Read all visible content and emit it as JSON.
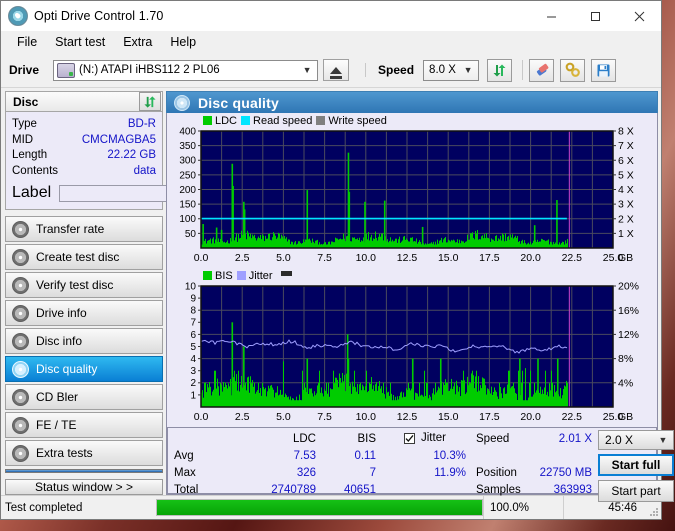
{
  "window": {
    "title": "Opti Drive Control 1.70",
    "app_icon": "disc-icon",
    "minimize": "minimize-icon",
    "maximize": "maximize-icon",
    "close": "close-icon"
  },
  "menu": {
    "items": [
      "File",
      "Start test",
      "Extra",
      "Help"
    ]
  },
  "toolbar": {
    "drive_label": "Drive",
    "drive_value": "(N:)  ATAPI iHBS112  2 PL06",
    "eject_icon": "eject-icon",
    "speed_label": "Speed",
    "speed_value": "8.0 X",
    "refresh_icon": "refresh-icon",
    "eraser_icon": "eraser-icon",
    "tools_icon": "tools-icon",
    "save_icon": "save-icon"
  },
  "disc_panel": {
    "header": "Disc",
    "refresh_icon": "refresh-icon",
    "rows": [
      {
        "key": "Type",
        "value": "BD-R"
      },
      {
        "key": "MID",
        "value": "CMCMAGBA5"
      },
      {
        "key": "Length",
        "value": "22.22 GB"
      },
      {
        "key": "Contents",
        "value": "data"
      }
    ],
    "label_key": "Label",
    "label_value": "",
    "label_placeholder": "",
    "label_disc_icon": "disc-icon"
  },
  "nav": {
    "items": [
      {
        "label": "Transfer rate",
        "icon": "disc-icon",
        "active": false
      },
      {
        "label": "Create test disc",
        "icon": "disc-icon",
        "active": false
      },
      {
        "label": "Verify test disc",
        "icon": "disc-icon",
        "active": false
      },
      {
        "label": "Drive info",
        "icon": "disc-icon",
        "active": false
      },
      {
        "label": "Disc info",
        "icon": "disc-icon",
        "active": false
      },
      {
        "label": "Disc quality",
        "icon": "disc-icon",
        "active": true
      },
      {
        "label": "CD Bler",
        "icon": "disc-icon",
        "active": false
      },
      {
        "label": "FE / TE",
        "icon": "disc-icon",
        "active": false
      },
      {
        "label": "Extra tests",
        "icon": "disc-icon",
        "active": false
      }
    ],
    "status_window_button": "Status window > >"
  },
  "panel": {
    "title": "Disc quality",
    "icon": "disc-icon"
  },
  "results": {
    "col_ldc": "LDC",
    "col_bis": "BIS",
    "jitter_label": "Jitter",
    "jitter_checked": true,
    "rows": [
      {
        "name": "Avg",
        "ldc": "7.53",
        "bis": "0.11",
        "jitter": "10.3%"
      },
      {
        "name": "Max",
        "ldc": "326",
        "bis": "7",
        "jitter": "11.9%"
      },
      {
        "name": "Total",
        "ldc": "2740789",
        "bis": "40651",
        "jitter": ""
      }
    ],
    "speed_key": "Speed",
    "speed_value": "2.01 X",
    "position_key": "Position",
    "position_value": "22750 MB",
    "samples_key": "Samples",
    "samples_value": "363993",
    "speed_select": "2.0 X",
    "start_full": "Start full",
    "start_part": "Start part"
  },
  "statusbar": {
    "message": "Test completed",
    "progress_percent_label": "100.0%",
    "progress_value": 100,
    "elapsed": "45:46",
    "grip_icon": "resize-grip-icon"
  },
  "colors": {
    "ldc_green": "#00cc00",
    "read_speed_cyan": "#00e5ff",
    "write_speed_gray": "#808080",
    "bis_green": "#00cc00",
    "jitter_lilac": "#9f9fff",
    "plot_bg": "#000060",
    "grid": "#4a4a5e",
    "marker_magenta": "#cc44cc",
    "accent_blue": "#0a7fd4",
    "value_blue": "#1414c8",
    "title_bar_blue": "#2f76b4"
  },
  "chart_data": [
    {
      "type": "area",
      "id": "ldc-chart",
      "title": "",
      "xlabel": "GB",
      "ylabel": "",
      "xlim": [
        0,
        25
      ],
      "xticks": [
        0.0,
        2.5,
        5.0,
        7.5,
        10.0,
        12.5,
        15.0,
        17.5,
        20.0,
        22.5,
        25.0
      ],
      "xticklabels": [
        "0.0",
        "2.5",
        "5.0",
        "7.5",
        "10.0",
        "12.5",
        "15.0",
        "17.5",
        "20.0",
        "22.5",
        "25.0"
      ],
      "x_unit_label": "GB",
      "ylim": [
        0,
        400
      ],
      "yticks": [
        50,
        100,
        150,
        200,
        250,
        300,
        350,
        400
      ],
      "yticklabels": [
        "50",
        "100",
        "150",
        "200",
        "250",
        "300",
        "350",
        "400"
      ],
      "y2lim": [
        0,
        8
      ],
      "y2ticks": [
        1,
        2,
        3,
        4,
        5,
        6,
        7,
        8
      ],
      "y2ticklabels": [
        "1 X",
        "2 X",
        "3 X",
        "4 X",
        "5 X",
        "6 X",
        "7 X",
        "8 X"
      ],
      "grid": true,
      "data_end_x": 22.2,
      "legend": [
        "LDC",
        "Read speed",
        "Write speed"
      ],
      "legend_position": "top-left",
      "series": [
        {
          "name": "LDC",
          "kind": "bars",
          "color": "#00cc00",
          "baseline_avg": 34,
          "noise_amplitude": 22,
          "spikes": [
            {
              "x": 0.08,
              "y": 82
            },
            {
              "x": 0.9,
              "y": 70
            },
            {
              "x": 1.2,
              "y": 62
            },
            {
              "x": 1.85,
              "y": 288
            },
            {
              "x": 1.9,
              "y": 212
            },
            {
              "x": 2.55,
              "y": 158
            },
            {
              "x": 2.6,
              "y": 132
            },
            {
              "x": 6.4,
              "y": 198
            },
            {
              "x": 8.9,
              "y": 326
            },
            {
              "x": 8.95,
              "y": 192
            },
            {
              "x": 9.9,
              "y": 158
            },
            {
              "x": 11.1,
              "y": 162
            },
            {
              "x": 21.55,
              "y": 164
            },
            {
              "x": 20.2,
              "y": 78
            },
            {
              "x": 13.4,
              "y": 72
            }
          ]
        },
        {
          "name": "Read speed",
          "kind": "line",
          "color": "#00e5ff",
          "axis": "right",
          "constant_value": 2.01
        },
        {
          "name": "Write speed",
          "kind": "line",
          "color": "#808080",
          "axis": "right",
          "values": []
        }
      ]
    },
    {
      "type": "area",
      "id": "bis-chart",
      "title": "",
      "xlabel": "GB",
      "xlim": [
        0,
        25
      ],
      "xticks": [
        0.0,
        2.5,
        5.0,
        7.5,
        10.0,
        12.5,
        15.0,
        17.5,
        20.0,
        22.5,
        25.0
      ],
      "xticklabels": [
        "0.0",
        "2.5",
        "5.0",
        "7.5",
        "10.0",
        "12.5",
        "15.0",
        "17.5",
        "20.0",
        "22.5",
        "25.0"
      ],
      "x_unit_label": "GB",
      "ylim": [
        0,
        10
      ],
      "yticks": [
        1,
        2,
        3,
        4,
        5,
        6,
        7,
        8,
        9,
        10
      ],
      "yticklabels": [
        "1",
        "2",
        "3",
        "4",
        "5",
        "6",
        "7",
        "8",
        "9",
        "10"
      ],
      "y2lim": [
        0,
        20
      ],
      "y2ticks": [
        4,
        8,
        12,
        16,
        20
      ],
      "y2ticklabels": [
        "4%",
        "8%",
        "12%",
        "16%",
        "20%"
      ],
      "grid": true,
      "data_end_x": 22.2,
      "legend": [
        "BIS",
        "Jitter"
      ],
      "legend_position": "top-left",
      "series": [
        {
          "name": "BIS",
          "kind": "bars",
          "color": "#00cc00",
          "baseline_avg": 1.6,
          "noise_amplitude": 1.3,
          "spikes": [
            {
              "x": 1.85,
              "y": 7
            },
            {
              "x": 2.55,
              "y": 5
            },
            {
              "x": 6.4,
              "y": 4
            },
            {
              "x": 8.85,
              "y": 6
            },
            {
              "x": 8.9,
              "y": 4
            },
            {
              "x": 12.8,
              "y": 4
            },
            {
              "x": 14.5,
              "y": 4
            },
            {
              "x": 19.3,
              "y": 4
            },
            {
              "x": 20.4,
              "y": 4
            },
            {
              "x": 21.6,
              "y": 4
            }
          ]
        },
        {
          "name": "Jitter",
          "kind": "line",
          "color": "#9f9fff",
          "axis": "right",
          "avg_percent": 10.3,
          "max_percent": 11.9,
          "start_percent": 10.6,
          "end_percent": 9.5
        }
      ]
    }
  ]
}
